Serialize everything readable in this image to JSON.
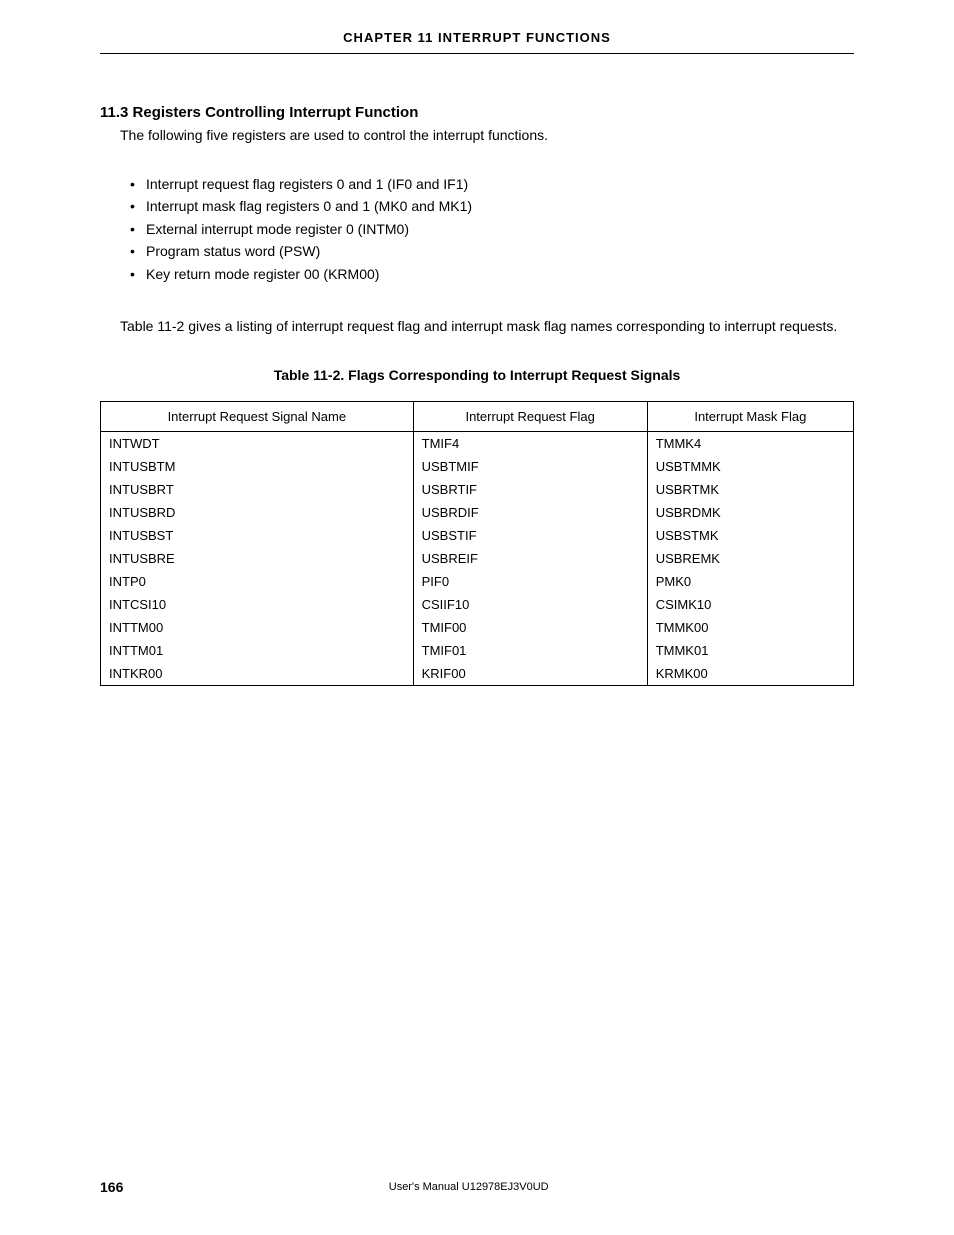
{
  "header": {
    "chapter": "CHAPTER  11   INTERRUPT  FUNCTIONS"
  },
  "section": {
    "heading": "11.3 Registers Controlling Interrupt Function",
    "intro": "The following five registers are used to control the interrupt functions.",
    "bullets": [
      "Interrupt request flag registers 0 and 1 (IF0 and IF1)",
      "Interrupt mask flag registers 0 and 1 (MK0 and MK1)",
      "External interrupt mode register 0 (INTM0)",
      "Program status word (PSW)",
      "Key return mode register 00 (KRM00)"
    ],
    "paragraph": "Table 11-2 gives a listing of interrupt request flag and interrupt mask flag names corresponding to interrupt requests."
  },
  "table": {
    "caption": "Table 11-2.  Flags Corresponding to Interrupt Request Signals",
    "headers": [
      "Interrupt Request Signal Name",
      "Interrupt Request Flag",
      "Interrupt Mask Flag"
    ],
    "rows": [
      [
        "INTWDT",
        "TMIF4",
        "TMMK4"
      ],
      [
        "INTUSBTM",
        "USBTMIF",
        "USBTMMK"
      ],
      [
        "INTUSBRT",
        "USBRTIF",
        "USBRTMK"
      ],
      [
        "INTUSBRD",
        "USBRDIF",
        "USBRDMK"
      ],
      [
        "INTUSBST",
        "USBSTIF",
        "USBSTMK"
      ],
      [
        "INTUSBRE",
        "USBREIF",
        "USBREMK"
      ],
      [
        "INTP0",
        "PIF0",
        "PMK0"
      ],
      [
        "INTCSI10",
        "CSIIF10",
        "CSIMK10"
      ],
      [
        "INTTM00",
        "TMIF00",
        "TMMK00"
      ],
      [
        "INTTM01",
        "TMIF01",
        "TMMK01"
      ],
      [
        "INTKR00",
        "KRIF00",
        "KRMK00"
      ]
    ]
  },
  "footer": {
    "page": "166",
    "text": "User's Manual  U12978EJ3V0UD"
  }
}
